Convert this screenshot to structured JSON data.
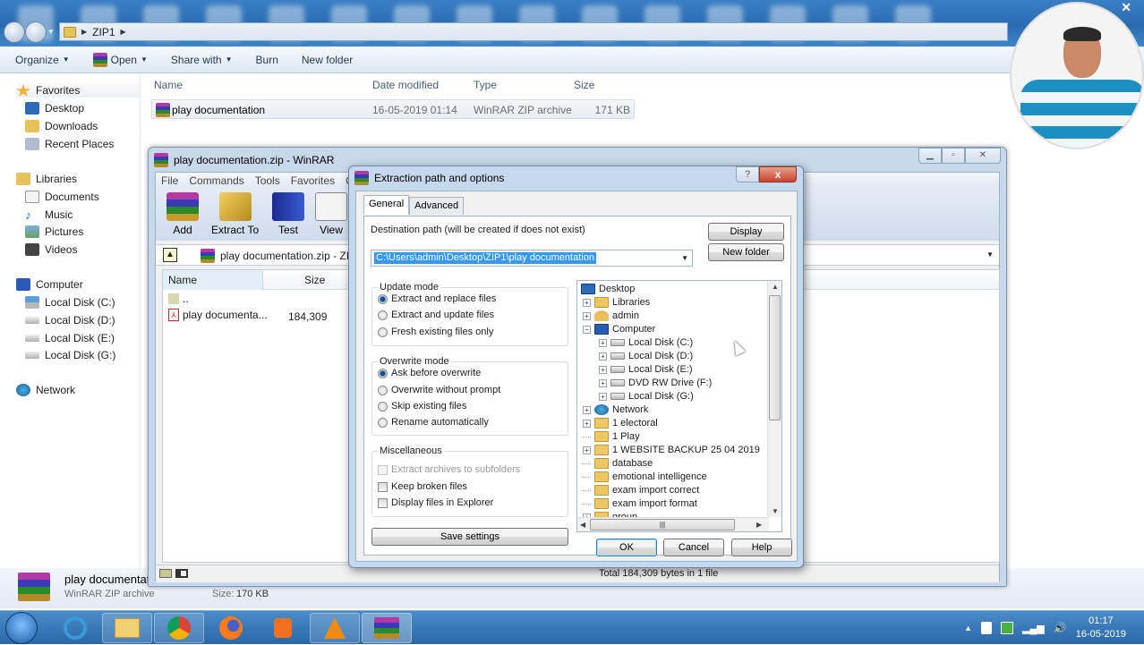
{
  "explorer": {
    "breadcrumb": [
      "ZIP1"
    ],
    "commands": [
      {
        "label": "Organize",
        "dropdown": true
      },
      {
        "label": "Open",
        "dropdown": true,
        "icon": "winrar-icon"
      },
      {
        "label": "Share with",
        "dropdown": true
      },
      {
        "label": "Burn",
        "dropdown": false
      },
      {
        "label": "New folder",
        "dropdown": false
      }
    ],
    "nav": {
      "favorites": {
        "label": "Favorites",
        "items": [
          "Desktop",
          "Downloads",
          "Recent Places"
        ]
      },
      "libraries": {
        "label": "Libraries",
        "items": [
          "Documents",
          "Music",
          "Pictures",
          "Videos"
        ]
      },
      "computer": {
        "label": "Computer",
        "items": [
          "Local Disk (C:)",
          "Local Disk (D:)",
          "Local Disk (E:)",
          "Local Disk (G:)"
        ]
      },
      "network": {
        "label": "Network"
      }
    },
    "columns": {
      "name": "Name",
      "date": "Date modified",
      "type": "Type",
      "size": "Size"
    },
    "files": [
      {
        "name": "play documentation",
        "date": "16-05-2019 01:14",
        "type": "WinRAR ZIP archive",
        "size": "171 KB"
      }
    ],
    "details": {
      "name": "play documentat",
      "type": "WinRAR ZIP archive",
      "size_label": "Size:",
      "size": "170 KB"
    }
  },
  "winrar": {
    "title": "play documentation.zip - WinRAR",
    "menu": [
      "File",
      "Commands",
      "Tools",
      "Favorites",
      "Op"
    ],
    "tools": [
      "Add",
      "Extract To",
      "Test",
      "View"
    ],
    "path": "play documentation.zip - ZIP",
    "columns": {
      "name": "Name",
      "size": "Size"
    },
    "rows": [
      {
        "name": "..",
        "size": ""
      },
      {
        "name": "play documenta...",
        "size": "184,309"
      }
    ],
    "status": "Total 184,309 bytes in 1 file"
  },
  "dialog": {
    "title": "Extraction path and options",
    "help_glyph": "?",
    "close_glyph": "x",
    "tabs": [
      {
        "label": "General",
        "active": true
      },
      {
        "label": "Advanced",
        "active": false
      }
    ],
    "dest_label": "Destination path (will be created if does not exist)",
    "dest_value": "C:\\Users\\admin\\Desktop\\ZIP1\\play documentation",
    "display_btn": "Display",
    "new_folder_btn": "New folder",
    "update_mode": {
      "title": "Update mode",
      "options": [
        {
          "label": "Extract and replace files",
          "selected": true
        },
        {
          "label": "Extract and update files",
          "selected": false
        },
        {
          "label": "Fresh existing files only",
          "selected": false
        }
      ]
    },
    "overwrite_mode": {
      "title": "Overwrite mode",
      "options": [
        {
          "label": "Ask before overwrite",
          "selected": true
        },
        {
          "label": "Overwrite without prompt",
          "selected": false
        },
        {
          "label": "Skip existing files",
          "selected": false
        },
        {
          "label": "Rename automatically",
          "selected": false
        }
      ]
    },
    "misc": {
      "title": "Miscellaneous",
      "options": [
        {
          "label": "Extract archives to subfolders",
          "checked": false,
          "disabled": true
        },
        {
          "label": "Keep broken files",
          "checked": false,
          "disabled": false
        },
        {
          "label": "Display files in Explorer",
          "checked": false,
          "disabled": false
        }
      ]
    },
    "save_btn": "Save settings",
    "tree": [
      {
        "label": "Desktop",
        "level": 0,
        "icon": "desktop",
        "expander": ""
      },
      {
        "label": "Libraries",
        "level": 1,
        "icon": "folder",
        "expander": "+"
      },
      {
        "label": "admin",
        "level": 1,
        "icon": "user",
        "expander": "+"
      },
      {
        "label": "Computer",
        "level": 1,
        "icon": "computer",
        "expander": "-"
      },
      {
        "label": "Local Disk (C:)",
        "level": 2,
        "icon": "drive",
        "expander": "+"
      },
      {
        "label": "Local Disk (D:)",
        "level": 2,
        "icon": "drive",
        "expander": "+"
      },
      {
        "label": "Local Disk (E:)",
        "level": 2,
        "icon": "drive",
        "expander": "+"
      },
      {
        "label": "DVD RW Drive (F:)",
        "level": 2,
        "icon": "drive",
        "expander": "+"
      },
      {
        "label": "Local Disk (G:)",
        "level": 2,
        "icon": "drive",
        "expander": "+"
      },
      {
        "label": "Network",
        "level": 1,
        "icon": "network",
        "expander": "+"
      },
      {
        "label": "1 electoral",
        "level": 1,
        "icon": "folder",
        "expander": "+"
      },
      {
        "label": "1 Play",
        "level": 1,
        "icon": "folder",
        "expander": ""
      },
      {
        "label": "1 WEBSITE BACKUP 25 04 2019",
        "level": 1,
        "icon": "folder",
        "expander": "+"
      },
      {
        "label": "database",
        "level": 1,
        "icon": "folder",
        "expander": ""
      },
      {
        "label": "emotional intelligence",
        "level": 1,
        "icon": "folder",
        "expander": ""
      },
      {
        "label": "exam import correct",
        "level": 1,
        "icon": "folder",
        "expander": ""
      },
      {
        "label": "exam import format",
        "level": 1,
        "icon": "folder",
        "expander": ""
      },
      {
        "label": "group",
        "level": 1,
        "icon": "folder",
        "expander": "+"
      }
    ],
    "ok_btn": "OK",
    "cancel_btn": "Cancel",
    "help_btn": "Help"
  },
  "taskbar": {
    "apps": [
      "Internet Explorer",
      "Windows Explorer",
      "Google Chrome",
      "Firefox",
      "Media Player",
      "VLC",
      "WinRAR"
    ],
    "clock": {
      "time": "01:17",
      "date": "16-05-2019"
    }
  }
}
